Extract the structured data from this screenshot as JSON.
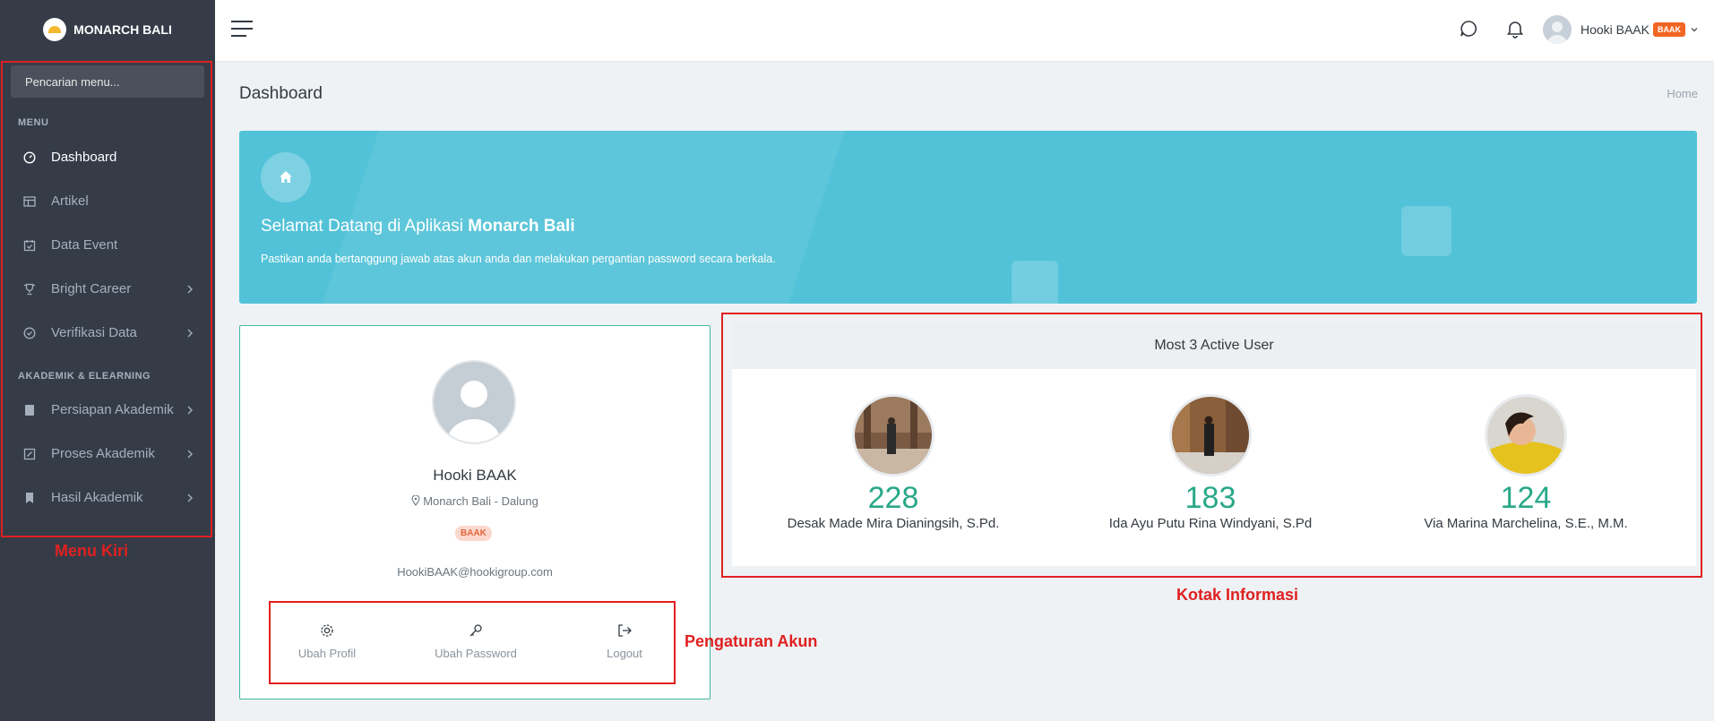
{
  "brand": {
    "name": "MONARCH BALI"
  },
  "sidebar": {
    "search_placeholder": "Pencarian menu...",
    "sections": [
      {
        "label": "MENU"
      },
      {
        "label": "AKADEMIK & ELEARNING"
      }
    ],
    "items": [
      {
        "label": "Dashboard",
        "icon": "dashboard-icon",
        "has_submenu": false,
        "active": true
      },
      {
        "label": "Artikel",
        "icon": "layout-icon",
        "has_submenu": false
      },
      {
        "label": "Data Event",
        "icon": "calendar-check-icon",
        "has_submenu": false
      },
      {
        "label": "Bright Career",
        "icon": "trophy-icon",
        "has_submenu": true
      },
      {
        "label": "Verifikasi Data",
        "icon": "check-circle-icon",
        "has_submenu": true
      },
      {
        "label": "Persiapan Akademik",
        "icon": "book-icon",
        "has_submenu": true
      },
      {
        "label": "Proses Akademik",
        "icon": "edit-square-icon",
        "has_submenu": true
      },
      {
        "label": "Hasil Akademik",
        "icon": "bookmark-icon",
        "has_submenu": true
      }
    ]
  },
  "topbar": {
    "user_name": "Hooki BAAK",
    "user_badge": "BAAK"
  },
  "page": {
    "title": "Dashboard",
    "breadcrumb": "Home"
  },
  "banner": {
    "title_prefix": "Selamat Datang di Aplikasi ",
    "title_brand": "Monarch Bali",
    "message": "Pastikan anda bertanggung jawab atas akun anda dan melakukan pergantian password secara berkala."
  },
  "profile": {
    "name": "Hooki BAAK",
    "location": "Monarch Bali - Dalung",
    "role": "BAAK",
    "email": "HookiBAAK@hookigroup.com",
    "actions": [
      {
        "label": "Ubah Profil",
        "icon": "gear-icon"
      },
      {
        "label": "Ubah Password",
        "icon": "key-icon"
      },
      {
        "label": "Logout",
        "icon": "logout-icon"
      }
    ]
  },
  "active_users": {
    "title": "Most 3 Active User",
    "users": [
      {
        "count": "228",
        "name": "Desak Made Mira Dianingsih, S.Pd."
      },
      {
        "count": "183",
        "name": "Ida Ayu Putu Rina Windyani, S.Pd"
      },
      {
        "count": "124",
        "name": "Via Marina Marchelina, S.E., M.M."
      }
    ]
  },
  "annotations": {
    "menu_kiri": "Menu Kiri",
    "pengaturan_akun": "Pengaturan Akun",
    "kotak_informasi": "Kotak Informasi"
  },
  "colors": {
    "sidebar_bg": "#353c48",
    "banner_bg": "#52c2d8",
    "accent_green": "#29a889",
    "annotation_red": "#e02020",
    "badge_orange": "#f26522"
  }
}
